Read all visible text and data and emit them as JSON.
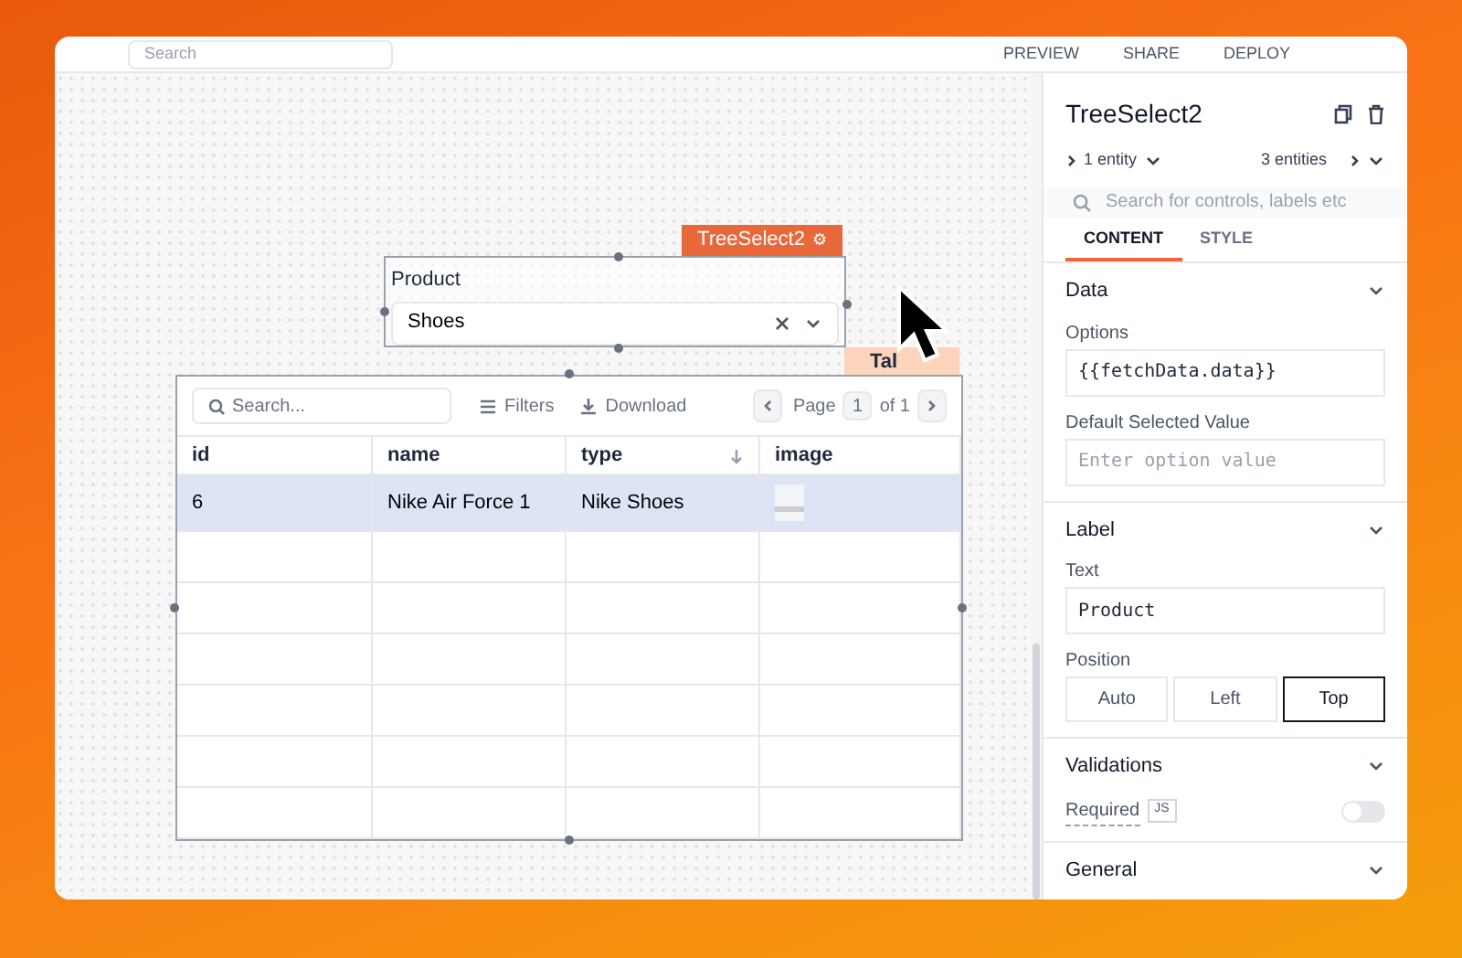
{
  "header": {
    "search_placeholder": "Search",
    "actions": [
      {
        "label": "PREVIEW"
      },
      {
        "label": "SHARE"
      },
      {
        "label": "DEPLOY"
      }
    ]
  },
  "canvas": {
    "treeselect": {
      "tag": "TreeSelect2",
      "tag_icon": "⚙",
      "label": "Product",
      "value": "Shoes"
    },
    "table_tag": "Tal",
    "table": {
      "search_placeholder": "Search...",
      "filters": "Filters",
      "download": "Download",
      "page_label": "Page",
      "page": "1",
      "page_of": "of 1",
      "columns": [
        {
          "label": "id",
          "sorted": false
        },
        {
          "label": "name",
          "sorted": false
        },
        {
          "label": "type",
          "sorted": true
        },
        {
          "label": "image",
          "sorted": false
        }
      ],
      "rows": [
        {
          "selected": true,
          "cells": [
            "6",
            "Nike Air Force 1",
            "Nike Shoes"
          ]
        }
      ]
    }
  },
  "panel": {
    "title": "TreeSelect2",
    "entity_left": "1 entity",
    "entity_right": "3 entities",
    "search_placeholder": "Search for controls, labels etc",
    "tabs": [
      {
        "label": "CONTENT",
        "selected": true
      },
      {
        "label": "STYLE",
        "selected": false
      }
    ],
    "sections": [
      {
        "title": "Data",
        "fields": [
          {
            "kind": "input",
            "label": "Options",
            "value": "{{fetchData.data}}"
          },
          {
            "kind": "input",
            "label": "Default Selected Value",
            "placeholder": "Enter option value"
          }
        ]
      },
      {
        "title": "Label",
        "fields": [
          {
            "kind": "input",
            "label": "Text",
            "value": "Product"
          },
          {
            "kind": "segmented",
            "label": "Position",
            "options": [
              {
                "label": "Auto",
                "selected": false
              },
              {
                "label": "Left",
                "selected": false
              },
              {
                "label": "Top",
                "selected": true
              }
            ]
          }
        ]
      },
      {
        "title": "Validations",
        "fields": [
          {
            "kind": "toggle",
            "label": "Required",
            "badge": "JS",
            "on": false
          }
        ]
      },
      {
        "title": "General"
      }
    ]
  }
}
